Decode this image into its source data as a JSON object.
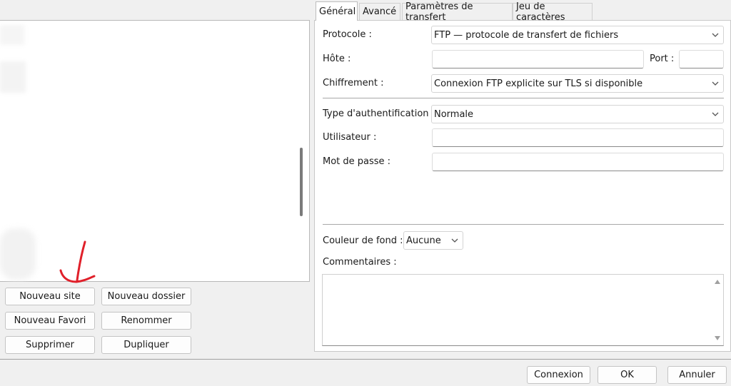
{
  "site_manager": {
    "buttons": {
      "new_site": "Nouveau site",
      "new_folder": "Nouveau dossier",
      "new_bookmark": "Nouveau Favori",
      "rename": "Renommer",
      "delete": "Supprimer",
      "duplicate": "Dupliquer"
    }
  },
  "tabs": [
    {
      "label": "Général",
      "active": true
    },
    {
      "label": "Avancé",
      "active": false
    },
    {
      "label": "Paramètres de transfert",
      "active": false
    },
    {
      "label": "Jeu de caractères",
      "active": false
    }
  ],
  "general": {
    "protocol_label": "Protocole :",
    "protocol_value": "FTP — protocole de transfert de fichiers",
    "host_label": "Hôte :",
    "host_value": "",
    "port_label": "Port :",
    "port_value": "",
    "encryption_label": "Chiffrement :",
    "encryption_value": "Connexion FTP explicite sur TLS si disponible",
    "auth_label": "Type d'authentification :",
    "auth_value": "Normale",
    "user_label": "Utilisateur :",
    "user_value": "",
    "password_label": "Mot de passe :",
    "password_value": "",
    "bgcolor_label": "Couleur de fond :",
    "bgcolor_value": "Aucune",
    "comments_label": "Commentaires :",
    "comments_value": ""
  },
  "dialog_buttons": {
    "connect": "Connexion",
    "ok": "OK",
    "cancel": "Annuler"
  },
  "colors": {
    "annotation": "#e0202a",
    "border": "#c4c4c4",
    "background": "#f0f0f0"
  },
  "icons": [
    "chevron-down-icon",
    "scroll-up-icon",
    "scroll-down-icon",
    "hand-drawn-arrow"
  ]
}
